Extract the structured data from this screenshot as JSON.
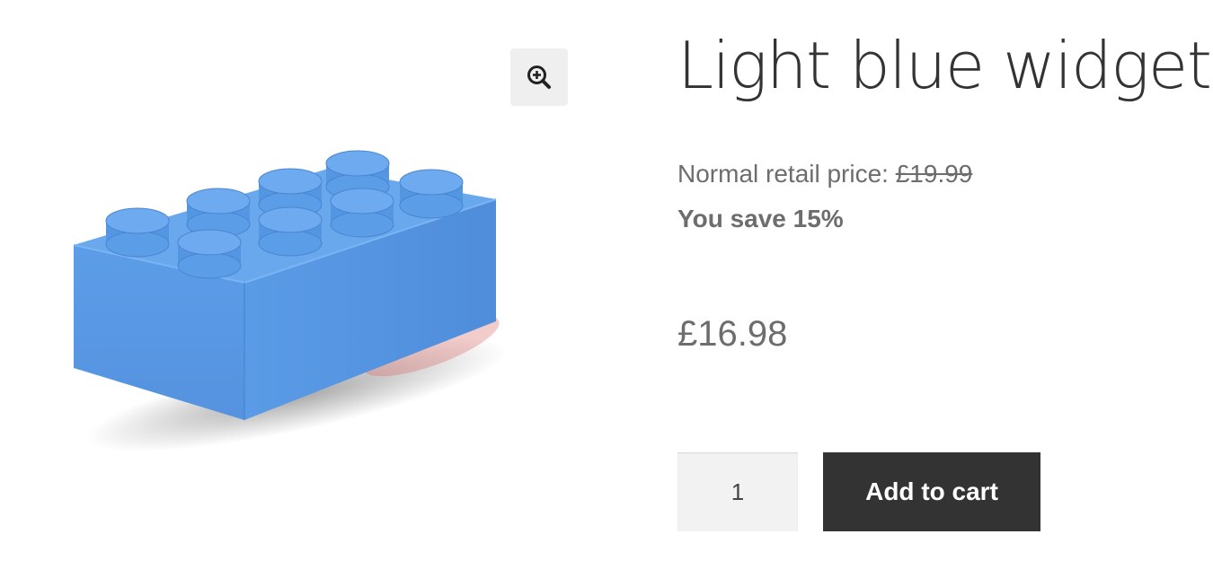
{
  "product": {
    "title": "Light blue widget",
    "retail_label": "Normal retail price: ",
    "retail_price": "£19.99",
    "savings_text": "You save 15%",
    "price": "£16.98"
  },
  "gallery": {
    "zoom_icon": "zoom-in-icon",
    "image_subject": "light blue toy building brick",
    "image_color": "#5a9be6"
  },
  "cart": {
    "quantity_value": "1",
    "add_to_cart_label": "Add to cart"
  },
  "colors": {
    "text_dark": "#333333",
    "text_muted": "#6d6d6d",
    "button_bg": "#333333",
    "zoom_bg": "#efefef"
  }
}
